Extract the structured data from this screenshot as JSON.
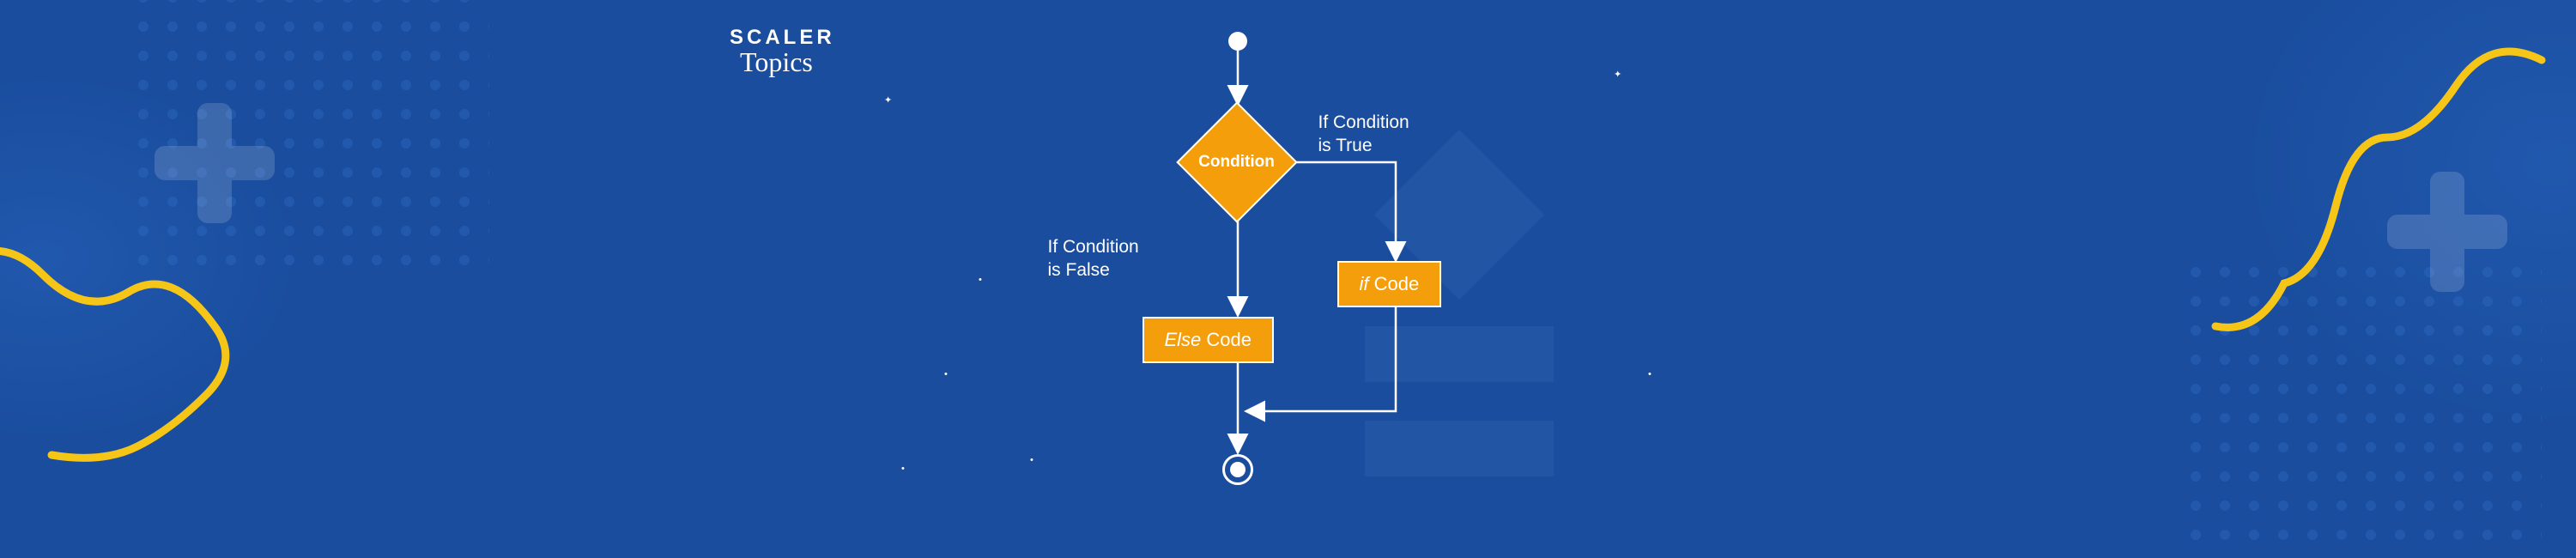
{
  "logo": {
    "main": "SCALER",
    "sub": "Topics"
  },
  "flowchart": {
    "condition": "Condition",
    "true_label": "If Condition\nis True",
    "false_label": "If Condition\nis False",
    "if_code": "if Code",
    "else_code": "Else Code"
  },
  "colors": {
    "bg": "#1a4d9e",
    "accent": "#f59e0b",
    "line": "#ffffff",
    "squiggle": "#f5c518"
  }
}
